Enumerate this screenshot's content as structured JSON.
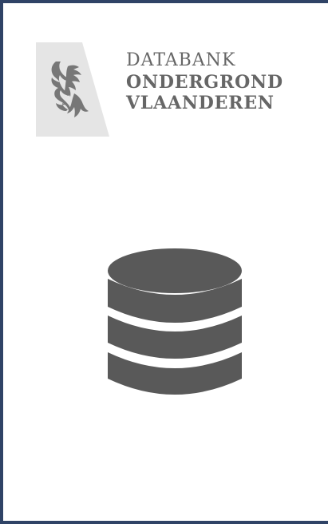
{
  "brand": {
    "line1": "DATABANK",
    "line2": "ONDERGROND",
    "line3": "VLAANDEREN",
    "logo_mark_icon": "flemish-lion-icon",
    "text_color": "#666666",
    "panel_color": "#e5e5e5"
  },
  "main_icon": {
    "name": "database-icon",
    "color": "#595959"
  },
  "frame": {
    "border_color": "#2f4366"
  }
}
